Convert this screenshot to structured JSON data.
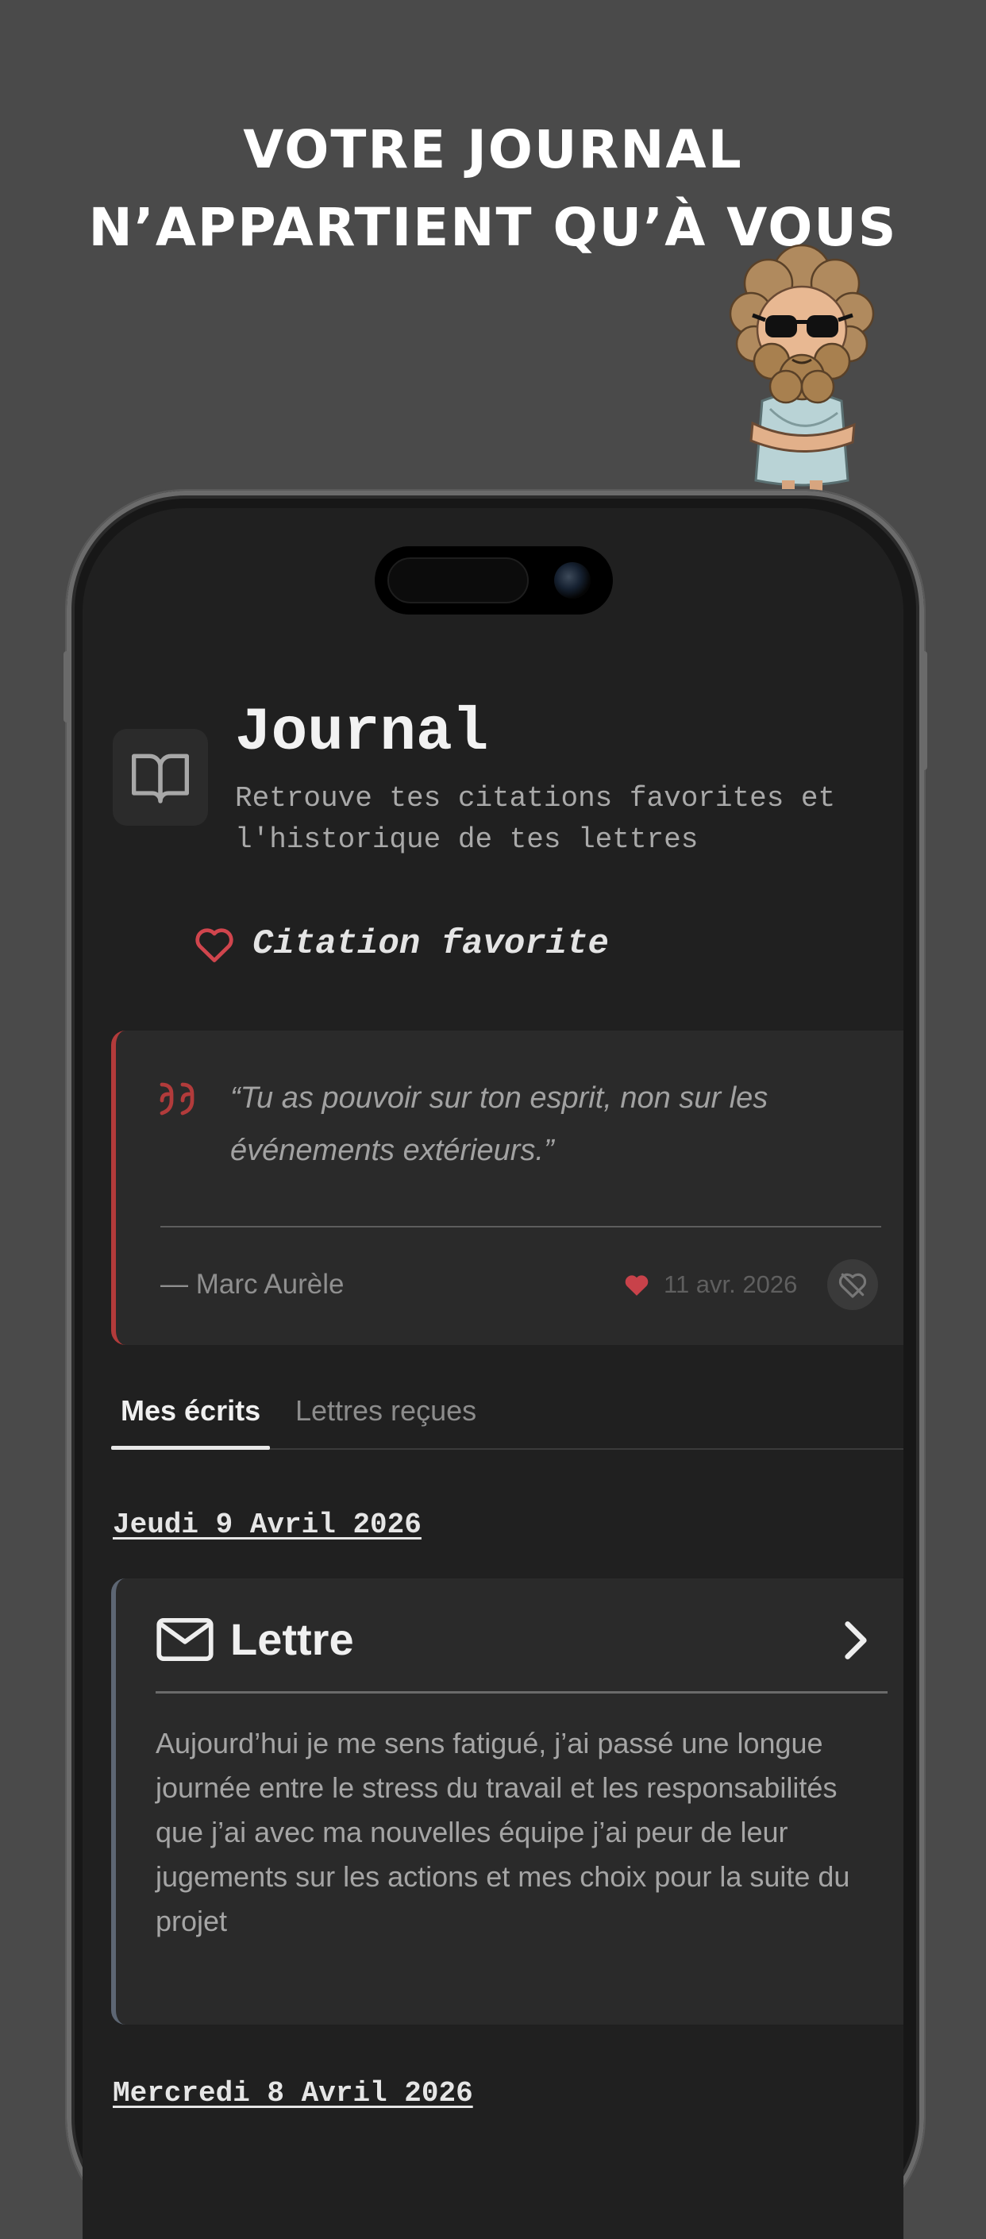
{
  "headline": {
    "line1": "VOTRE JOURNAL",
    "line2": "N’APPARTIENT QU’À VOUS"
  },
  "header": {
    "icon": "book-open-icon",
    "title": "Journal",
    "subtitle": "Retrouve tes citations favorites et l'historique de tes lettres"
  },
  "favorite_section": {
    "icon": "heart-outline-icon",
    "title": "Citation favorite",
    "quote": {
      "text": "“Tu as pouvoir sur ton esprit, non sur les événements extérieurs.”",
      "author": "— Marc Aurèle",
      "date": "11 avr. 2026"
    }
  },
  "tabs": [
    {
      "label": "Mes écrits",
      "active": true
    },
    {
      "label": "Lettres reçues",
      "active": false
    }
  ],
  "entries": [
    {
      "date": "Jeudi 9 Avril 2026",
      "type": "Lettre",
      "text": "Aujourd’hui je me sens fatigué, j’ai passé une longue journée entre le stress du travail et les responsabilités que j’ai avec ma nouvelles équipe j’ai peur de leur jugements sur les actions et mes choix pour la suite du projet"
    },
    {
      "date": "Mercredi 8 Avril 2026"
    }
  ],
  "colors": {
    "background": "#4a4a4a",
    "screen": "#202020",
    "accent_red": "#c8424a",
    "card": "#2a2a2a"
  }
}
